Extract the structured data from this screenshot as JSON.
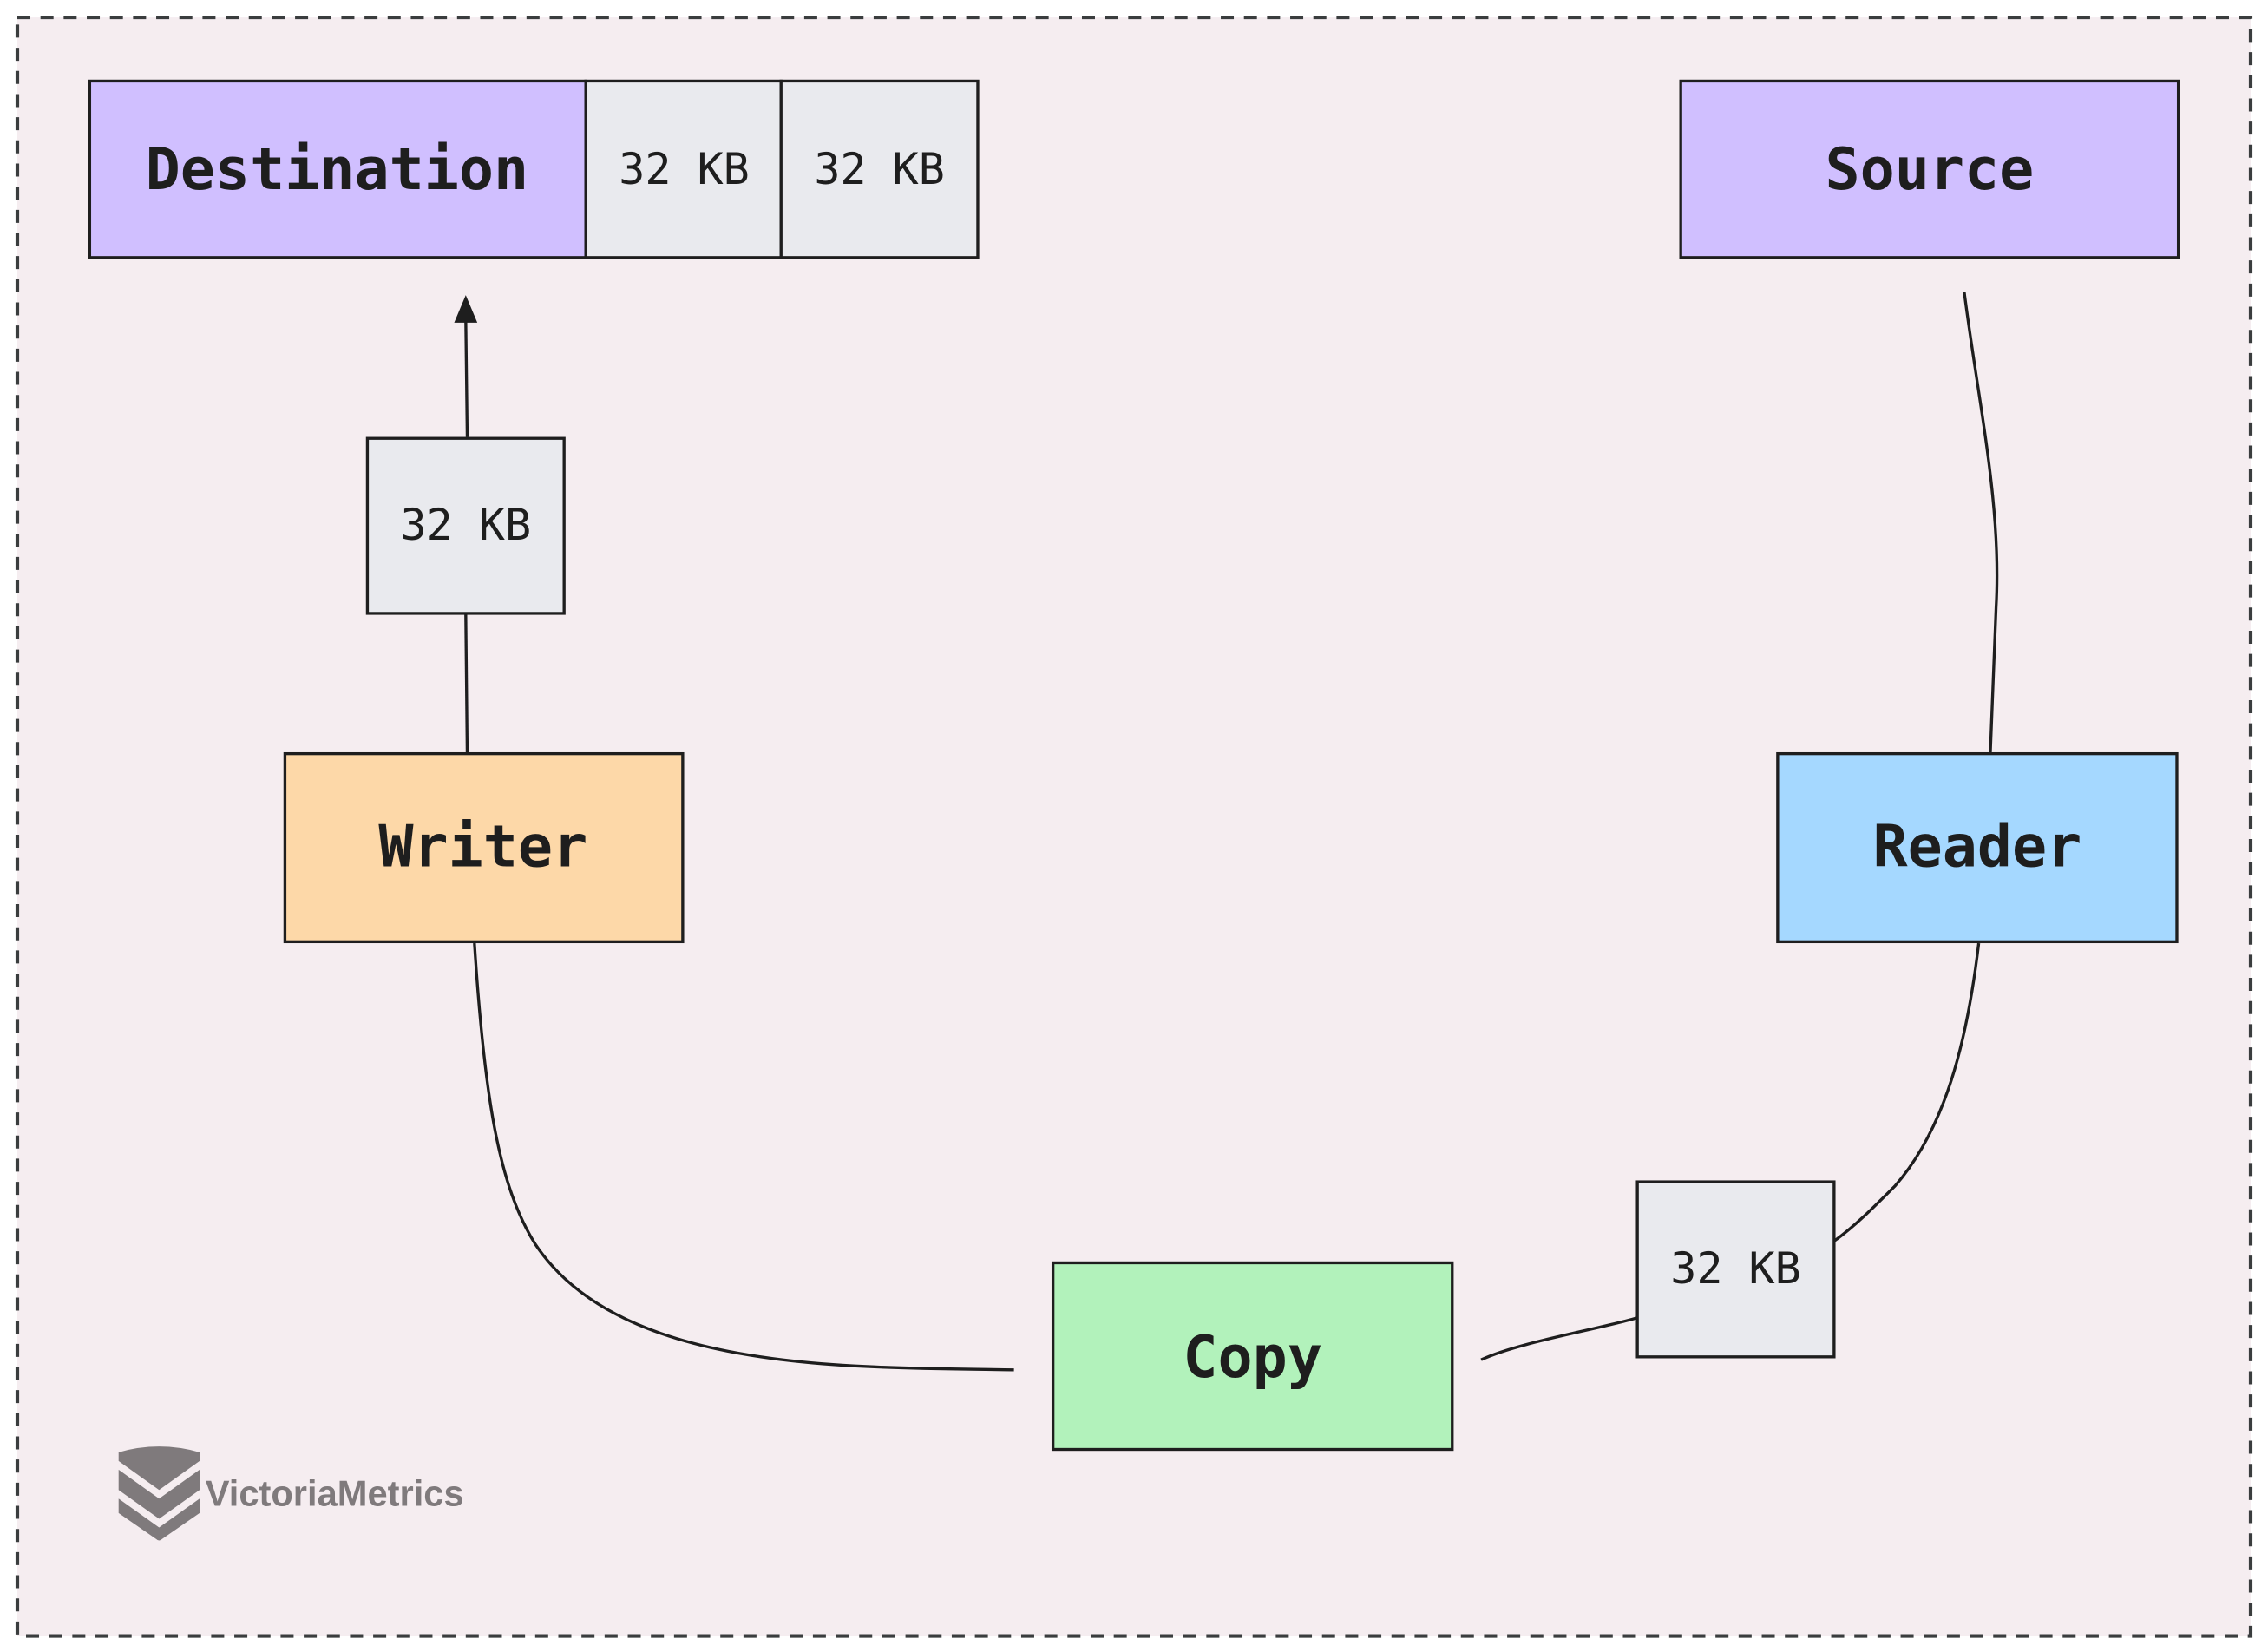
{
  "colors": {
    "background": "#f5edf0",
    "frame": "#3a3d3e",
    "storage": "#d0bfff",
    "buffer": "#e9eaee",
    "writer": "#fdd8a8",
    "reader": "#a5d8ff",
    "copy": "#b2f2bb",
    "logo": "#7f7a7c"
  },
  "nodes": {
    "destination": "Destination",
    "destination_buffers": [
      "32 KB",
      "32 KB"
    ],
    "source": "Source",
    "writer_buffer": "32 KB",
    "writer": "Writer",
    "reader": "Reader",
    "copy": "Copy",
    "reader_buffer": "32 KB"
  },
  "logo": {
    "text": "VictoriaMetrics",
    "icon": "victoriametrics-logo-icon"
  }
}
